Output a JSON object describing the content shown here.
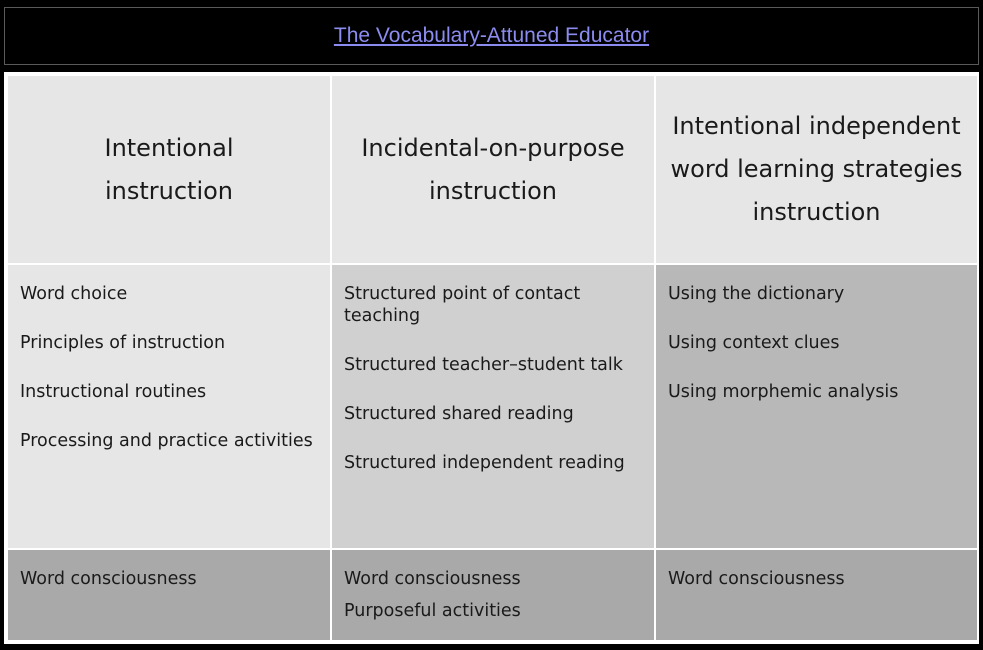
{
  "header": {
    "title_link": "The Vocabulary-Attuned Educator"
  },
  "table": {
    "columns": [
      {
        "heading": "Intentional instruction",
        "items": [
          "Word choice",
          "Principles of instruction",
          "Instructional routines",
          "Processing and practice activities"
        ],
        "footer": [
          "Word consciousness"
        ]
      },
      {
        "heading": "Incidental-on-purpose instruction",
        "items": [
          "Structured point of contact teaching",
          "Structured teacher–student talk",
          "Structured shared reading",
          "Structured independent reading"
        ],
        "footer": [
          "Word consciousness",
          "Purposeful activities"
        ]
      },
      {
        "heading": "Intentional independent word learning strategies instruction",
        "items": [
          "Using the dictionary",
          "Using context clues",
          "Using morphemic analysis"
        ],
        "footer": [
          "Word consciousness"
        ]
      }
    ]
  },
  "colors": {
    "page_background": "#000000",
    "link": "#8c8cf0",
    "cell_light": "#e6e6e6",
    "cell_mid": "#d0d0d0",
    "cell_dark": "#b8b8b8",
    "cell_footer": "#a9a9a9"
  }
}
